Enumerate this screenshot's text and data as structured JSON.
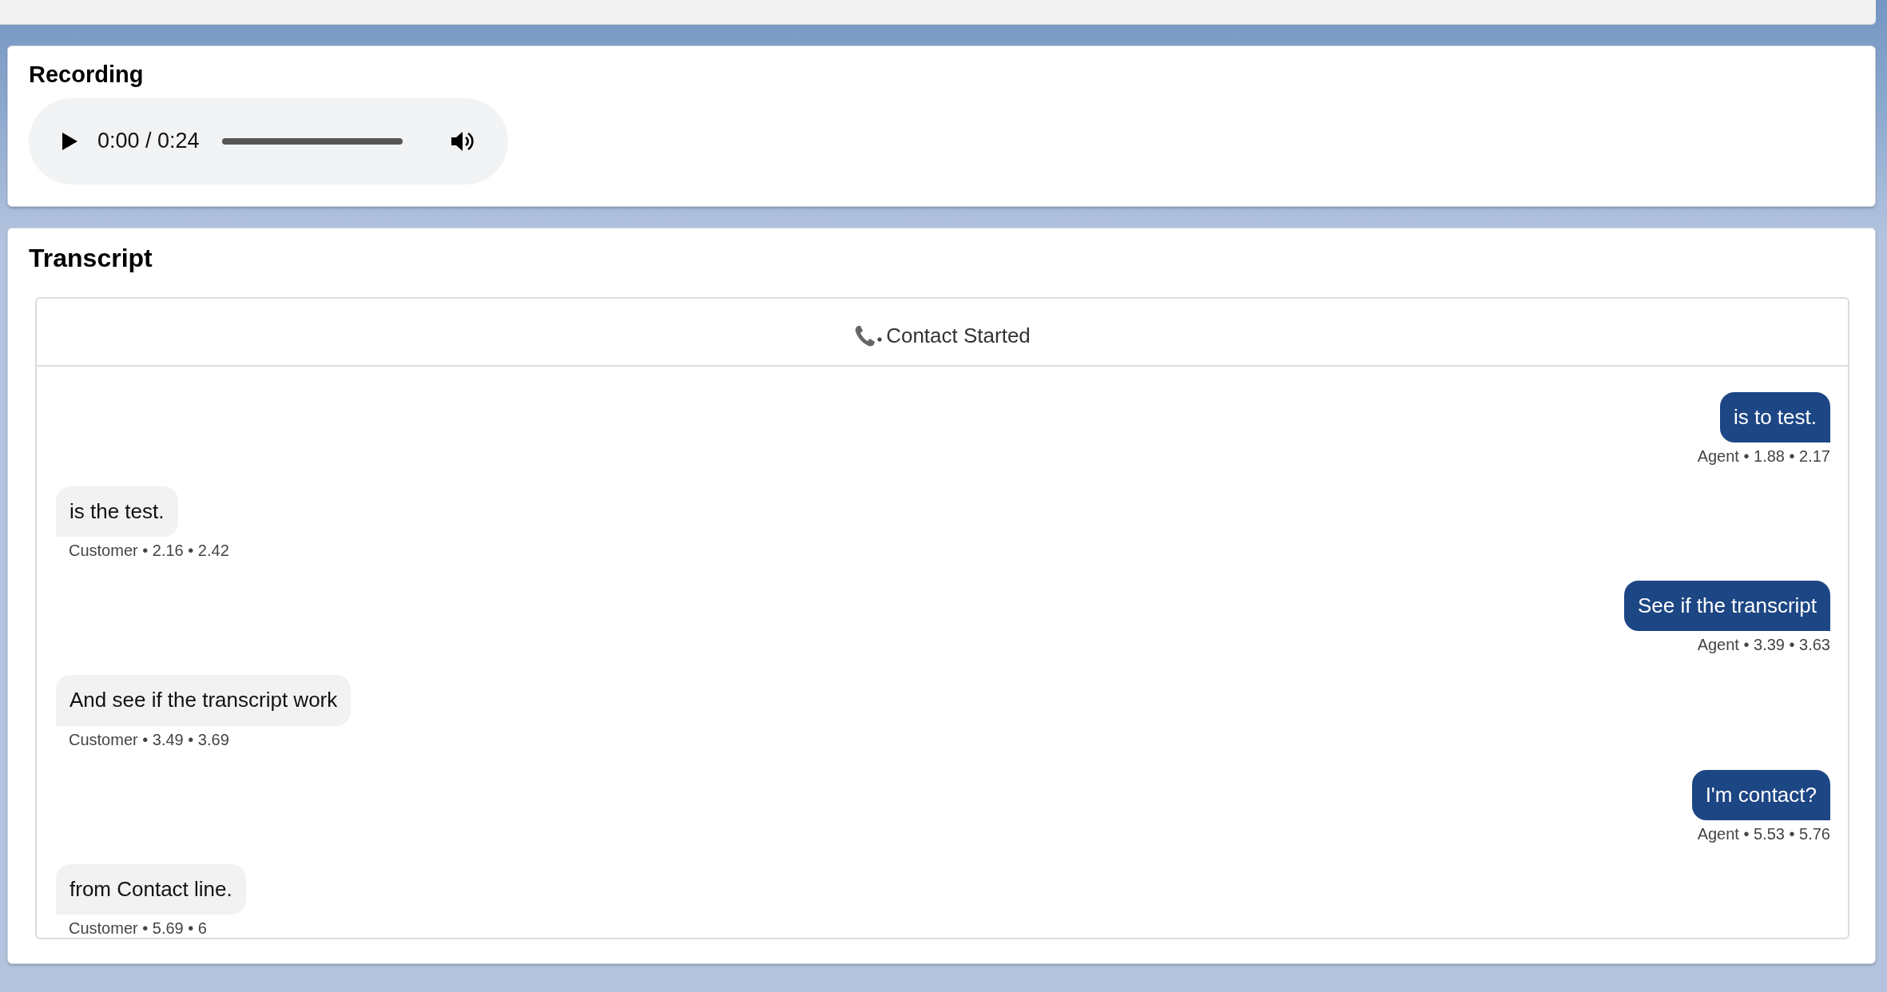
{
  "recording": {
    "title": "Recording",
    "player": {
      "time": "0:00 / 0:24"
    }
  },
  "transcript": {
    "title": "Transcript",
    "event": "Contact Started",
    "messages": [
      {
        "kind": "agent",
        "text": "is to test.",
        "meta": "Agent • 1.88 • 2.17"
      },
      {
        "kind": "customer",
        "text": "is the test.",
        "meta": "Customer • 2.16 • 2.42"
      },
      {
        "kind": "agent",
        "text": "See if the transcript",
        "meta": "Agent • 3.39 • 3.63"
      },
      {
        "kind": "customer",
        "text": "And see if the transcript work",
        "meta": "Customer • 3.49 • 3.69"
      },
      {
        "kind": "agent",
        "text": "I'm contact?",
        "meta": "Agent • 5.53 • 5.76"
      },
      {
        "kind": "customer",
        "text": "from Contact line.",
        "meta": "Customer • 5.69 • 6"
      }
    ]
  }
}
